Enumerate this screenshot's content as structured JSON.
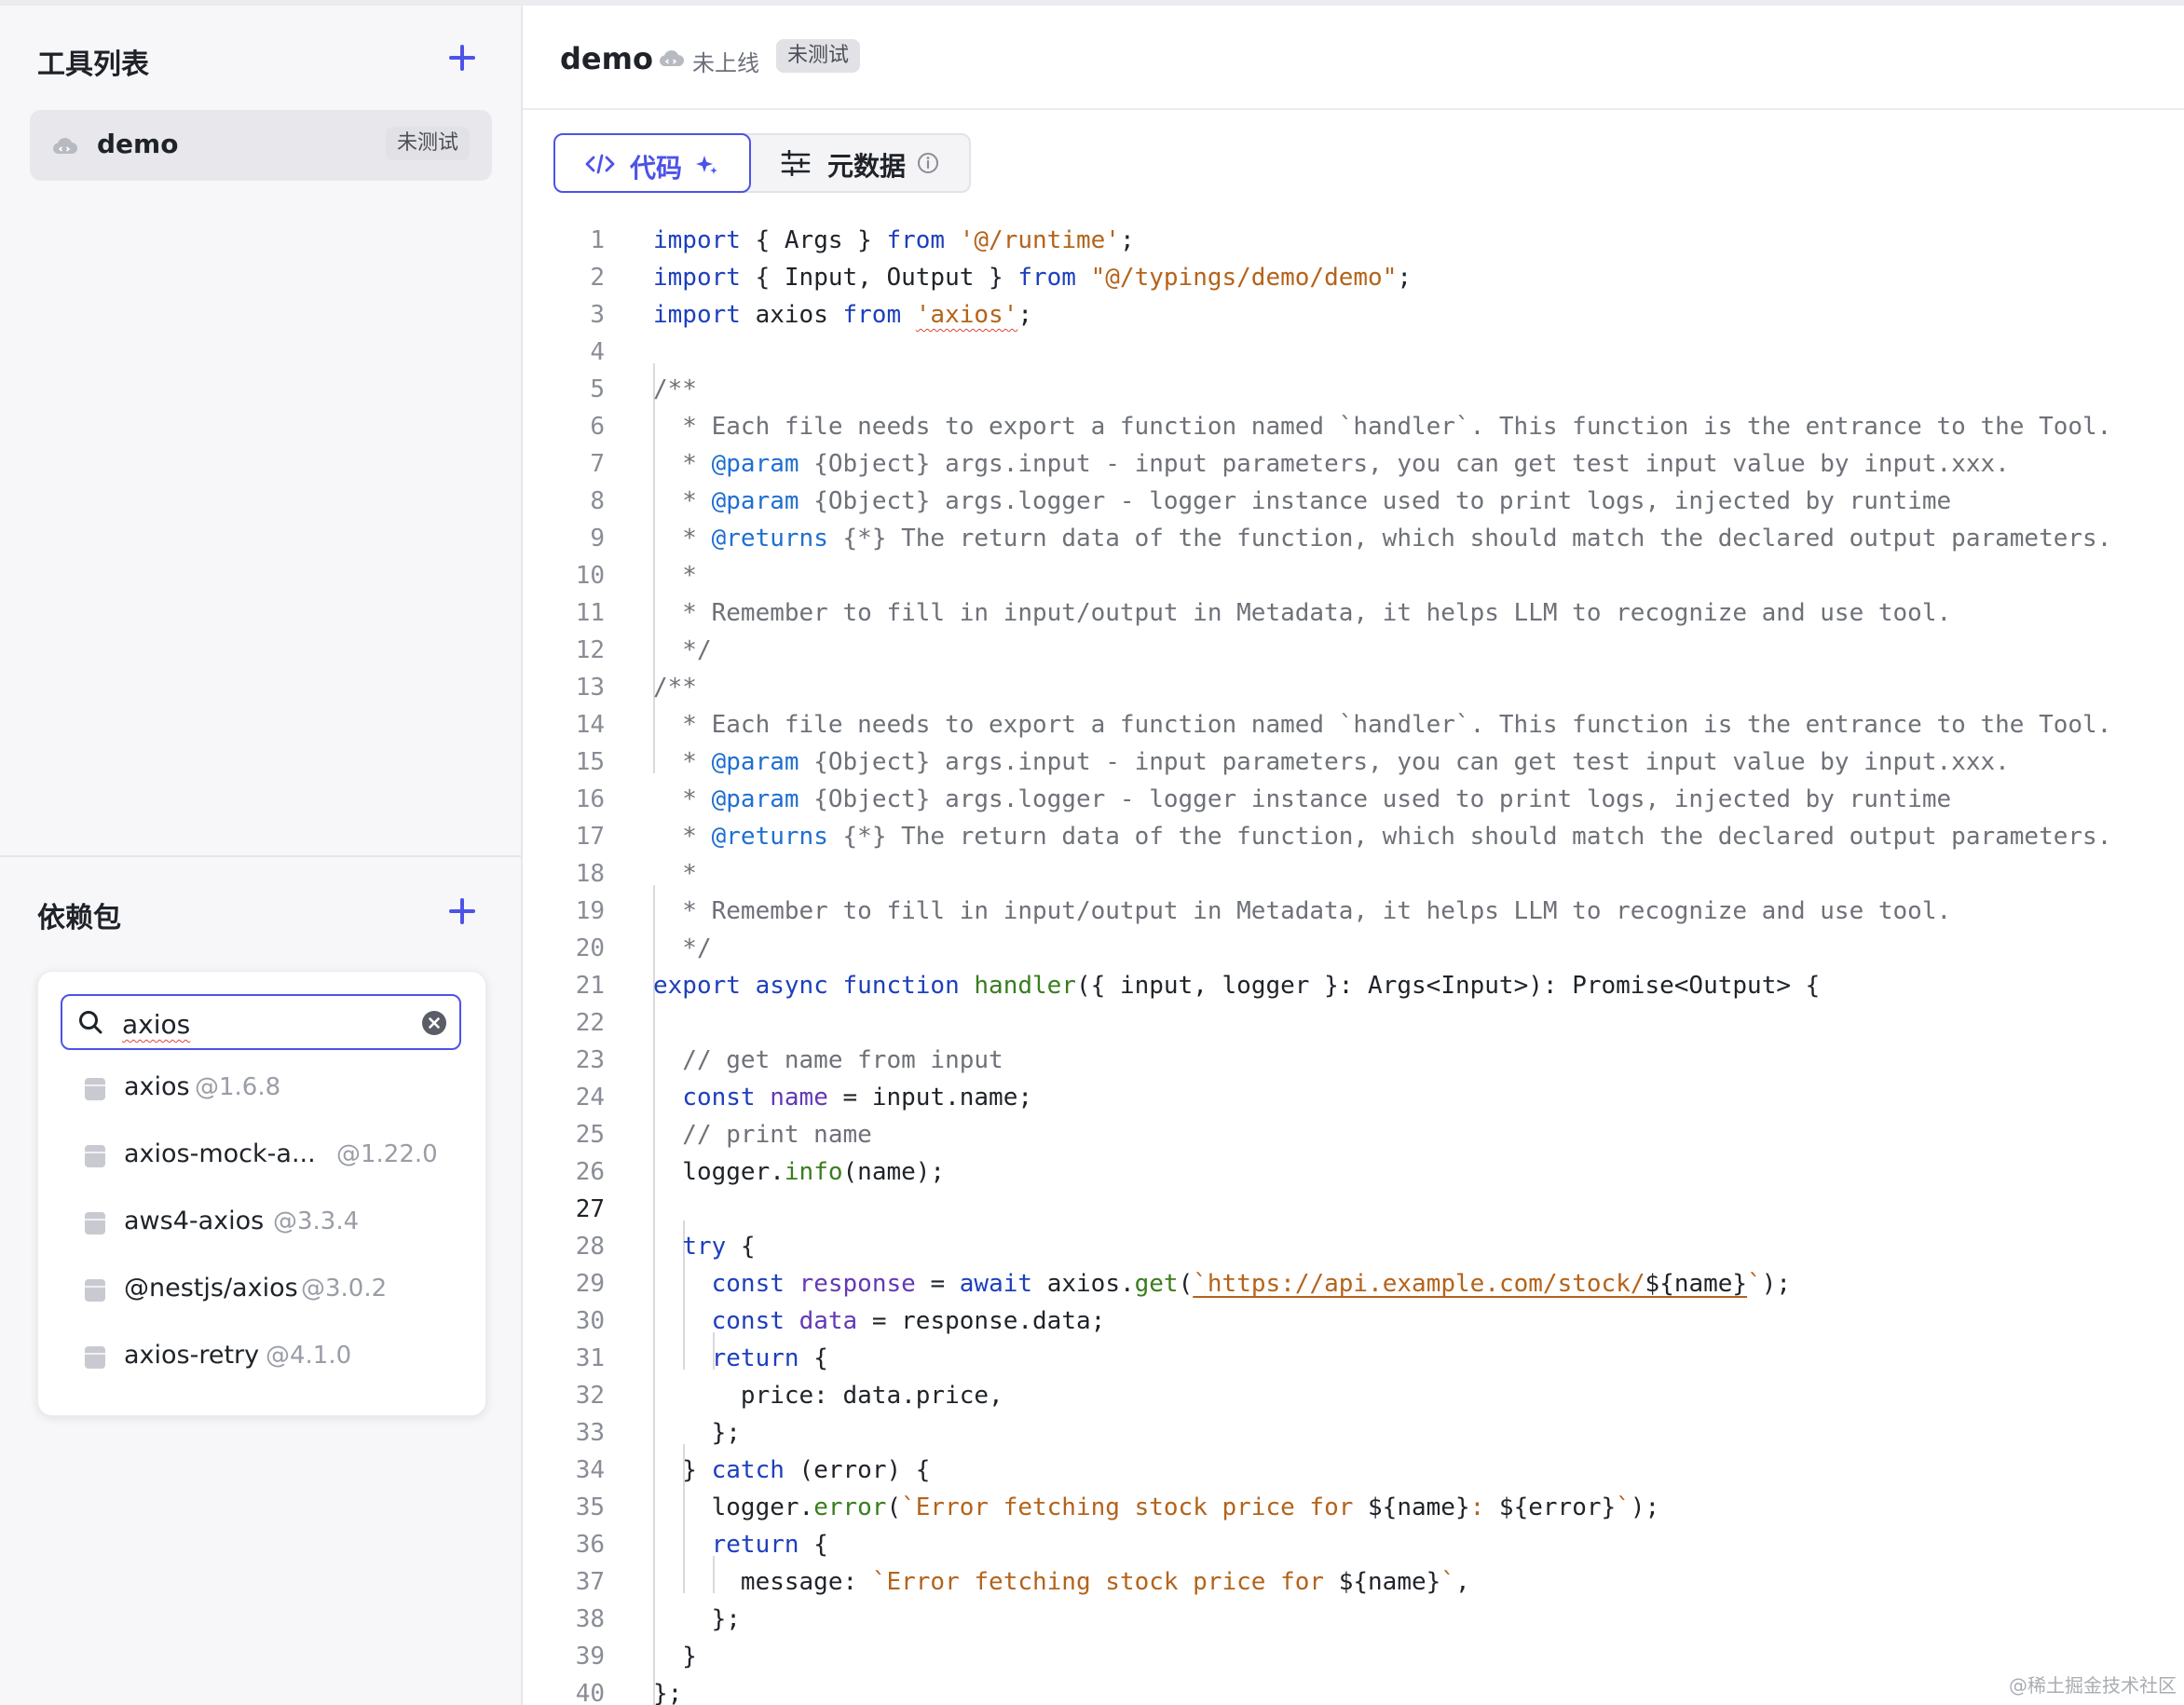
{
  "sidebar": {
    "tools_title": "工具列表",
    "tool_items": [
      {
        "name": "demo",
        "badge": "未测试"
      }
    ],
    "deps_title": "依赖包",
    "search": {
      "value": "axios"
    },
    "dependencies": [
      {
        "name": "axios",
        "version": "@1.6.8"
      },
      {
        "name": "axios-mock-a...",
        "version": "@1.22.0"
      },
      {
        "name": "aws4-axios",
        "version": "@3.3.4"
      },
      {
        "name": "@nestjs/axios",
        "version": "@3.0.2"
      },
      {
        "name": "axios-retry",
        "version": "@4.1.0"
      }
    ]
  },
  "header": {
    "title": "demo",
    "status": "未上线",
    "badge": "未测试"
  },
  "tabs": {
    "code_label": "代码",
    "metadata_label": "元数据"
  },
  "editor": {
    "active_line": 27,
    "lines": [
      {
        "n": "1",
        "t": [
          [
            "import",
            "kw"
          ],
          [
            " { Args } ",
            ""
          ],
          [
            "from",
            "kw"
          ],
          [
            " ",
            ""
          ],
          [
            "'@/runtime'",
            "str"
          ],
          [
            ";",
            ""
          ]
        ]
      },
      {
        "n": "2",
        "t": [
          [
            "import",
            "kw"
          ],
          [
            " { Input, Output } ",
            ""
          ],
          [
            "from",
            "kw"
          ],
          [
            " ",
            ""
          ],
          [
            "\"@/typings/demo/demo\"",
            "str"
          ],
          [
            ";",
            ""
          ]
        ]
      },
      {
        "n": "3",
        "t": [
          [
            "import",
            "kw"
          ],
          [
            " axios ",
            ""
          ],
          [
            "from",
            "kw"
          ],
          [
            " ",
            ""
          ],
          [
            "'axios'",
            "str err"
          ],
          [
            ";",
            ""
          ]
        ]
      },
      {
        "n": "4",
        "t": []
      },
      {
        "n": "5",
        "t": [
          [
            "/**",
            "com"
          ]
        ]
      },
      {
        "n": "6",
        "t": [
          [
            "  * Each file needs to export a function named `handler`. This function is the entrance to the Tool.",
            "com"
          ]
        ]
      },
      {
        "n": "7",
        "t": [
          [
            "  * ",
            "com"
          ],
          [
            "@param",
            "tag"
          ],
          [
            " {Object} args.input - input parameters, you can get test input value by input.xxx.",
            "com"
          ]
        ]
      },
      {
        "n": "8",
        "t": [
          [
            "  * ",
            "com"
          ],
          [
            "@param",
            "tag"
          ],
          [
            " {Object} args.logger - logger instance used to print logs, injected by runtime",
            "com"
          ]
        ]
      },
      {
        "n": "9",
        "t": [
          [
            "  * ",
            "com"
          ],
          [
            "@returns",
            "tag"
          ],
          [
            " {*} The return data of the function, which should match the declared output parameters.",
            "com"
          ]
        ]
      },
      {
        "n": "10",
        "t": [
          [
            "  *",
            "com"
          ]
        ]
      },
      {
        "n": "11",
        "t": [
          [
            "  * Remember to fill in input/output in Metadata, it helps LLM to recognize and use tool.",
            "com"
          ]
        ]
      },
      {
        "n": "12",
        "t": [
          [
            "  */",
            "com"
          ]
        ]
      },
      {
        "n": "13",
        "t": [
          [
            "/**",
            "com"
          ]
        ]
      },
      {
        "n": "14",
        "t": [
          [
            "  * Each file needs to export a function named `handler`. This function is the entrance to the Tool.",
            "com"
          ]
        ]
      },
      {
        "n": "15",
        "t": [
          [
            "  * ",
            "com"
          ],
          [
            "@param",
            "tag"
          ],
          [
            " {Object} args.input - input parameters, you can get test input value by input.xxx.",
            "com"
          ]
        ]
      },
      {
        "n": "16",
        "t": [
          [
            "  * ",
            "com"
          ],
          [
            "@param",
            "tag"
          ],
          [
            " {Object} args.logger - logger instance used to print logs, injected by runtime",
            "com"
          ]
        ]
      },
      {
        "n": "17",
        "t": [
          [
            "  * ",
            "com"
          ],
          [
            "@returns",
            "tag"
          ],
          [
            " {*} The return data of the function, which should match the declared output parameters.",
            "com"
          ]
        ]
      },
      {
        "n": "18",
        "t": [
          [
            "  *",
            "com"
          ]
        ]
      },
      {
        "n": "19",
        "t": [
          [
            "  * Remember to fill in input/output in Metadata, it helps LLM to recognize and use tool.",
            "com"
          ]
        ]
      },
      {
        "n": "20",
        "t": [
          [
            "  */",
            "com"
          ]
        ]
      },
      {
        "n": "21",
        "t": [
          [
            "export",
            "kw"
          ],
          [
            " ",
            ""
          ],
          [
            "async",
            "kw"
          ],
          [
            " ",
            ""
          ],
          [
            "function",
            "kw"
          ],
          [
            " ",
            ""
          ],
          [
            "handler",
            "fn"
          ],
          [
            "({ input, logger }: Args<Input>): Promise<Output> {",
            ""
          ]
        ]
      },
      {
        "n": "22",
        "t": []
      },
      {
        "n": "23",
        "t": [
          [
            "  // get name from input",
            "com"
          ]
        ]
      },
      {
        "n": "24",
        "t": [
          [
            "  ",
            ""
          ],
          [
            "const",
            "kw"
          ],
          [
            " ",
            ""
          ],
          [
            "name",
            "var"
          ],
          [
            " = input.name;",
            ""
          ]
        ]
      },
      {
        "n": "25",
        "t": [
          [
            "  // print name",
            "com"
          ]
        ]
      },
      {
        "n": "26",
        "t": [
          [
            "  logger.",
            ""
          ],
          [
            "info",
            "fn"
          ],
          [
            "(name);",
            ""
          ]
        ]
      },
      {
        "n": "27",
        "t": []
      },
      {
        "n": "28",
        "t": [
          [
            "  ",
            ""
          ],
          [
            "try",
            "kw"
          ],
          [
            " {",
            ""
          ]
        ]
      },
      {
        "n": "29",
        "t": [
          [
            "    ",
            ""
          ],
          [
            "const",
            "kw"
          ],
          [
            " ",
            ""
          ],
          [
            "response",
            "var"
          ],
          [
            " = ",
            ""
          ],
          [
            "await",
            "kw"
          ],
          [
            " axios.",
            ""
          ],
          [
            "get",
            "fn"
          ],
          [
            "(",
            ""
          ],
          [
            "`https://api.example.com/stock/",
            "str url"
          ],
          [
            "${name}",
            "url"
          ],
          [
            "`",
            "str"
          ],
          [
            ");",
            ""
          ]
        ]
      },
      {
        "n": "30",
        "t": [
          [
            "    ",
            ""
          ],
          [
            "const",
            "kw"
          ],
          [
            " ",
            ""
          ],
          [
            "data",
            "var"
          ],
          [
            " = response.data;",
            ""
          ]
        ]
      },
      {
        "n": "31",
        "t": [
          [
            "    ",
            ""
          ],
          [
            "return",
            "kw"
          ],
          [
            " {",
            ""
          ]
        ]
      },
      {
        "n": "32",
        "t": [
          [
            "      price: data.price,",
            ""
          ]
        ]
      },
      {
        "n": "33",
        "t": [
          [
            "    };",
            ""
          ]
        ]
      },
      {
        "n": "34",
        "t": [
          [
            "  } ",
            ""
          ],
          [
            "catch",
            "kw"
          ],
          [
            " (error) {",
            ""
          ]
        ]
      },
      {
        "n": "35",
        "t": [
          [
            "    logger.",
            ""
          ],
          [
            "error",
            "fn"
          ],
          [
            "(",
            ""
          ],
          [
            "`Error fetching stock price for ",
            "str"
          ],
          [
            "${name}",
            ""
          ],
          [
            ": ",
            "str"
          ],
          [
            "${error}",
            ""
          ],
          [
            "`",
            "str"
          ],
          [
            ");",
            ""
          ]
        ]
      },
      {
        "n": "36",
        "t": [
          [
            "    ",
            ""
          ],
          [
            "return",
            "kw"
          ],
          [
            " {",
            ""
          ]
        ]
      },
      {
        "n": "37",
        "t": [
          [
            "      message: ",
            ""
          ],
          [
            "`Error fetching stock price for ",
            "str"
          ],
          [
            "${name}",
            ""
          ],
          [
            "`",
            "str"
          ],
          [
            ",",
            ""
          ]
        ]
      },
      {
        "n": "38",
        "t": [
          [
            "    };",
            ""
          ]
        ]
      },
      {
        "n": "39",
        "t": [
          [
            "  }",
            ""
          ]
        ]
      },
      {
        "n": "40",
        "t": [
          [
            "};",
            ""
          ]
        ]
      }
    ]
  },
  "watermark": "@稀土掘金技术社区",
  "colors": {
    "accent": "#4d53e8",
    "keyword": "#1d3fbd",
    "string": "#b4631a",
    "comment": "#6e7178",
    "doc_tag": "#1f6fd1",
    "function": "#3a7d1e",
    "variable": "#6339b5"
  },
  "icons": {
    "tool_item": "cloud-icon",
    "header_status": "cloud-icon",
    "code_tab": "code-brackets-icon",
    "code_tab_extra": "sparkle-icon",
    "metadata_tab": "sliders-icon",
    "metadata_info": "info-icon",
    "search": "search-icon",
    "clear": "clear-icon",
    "package": "package-icon"
  }
}
